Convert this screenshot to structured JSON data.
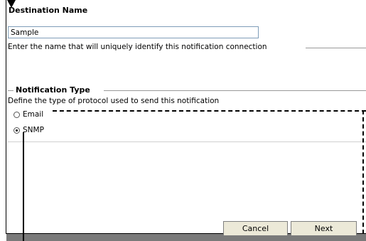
{
  "destination": {
    "heading": "Destination Name",
    "name_value": "Sample",
    "hint": "Enter the name that will uniquely identify this notification connection"
  },
  "notification": {
    "group_title": "Notification Type",
    "description": "Define the type of protocol used to send this notification",
    "options": [
      {
        "label": "Email",
        "selected": false
      },
      {
        "label": "SNMP",
        "selected": true
      }
    ]
  },
  "buttons": {
    "cancel_label": "Cancel",
    "next_label": "Next"
  }
}
